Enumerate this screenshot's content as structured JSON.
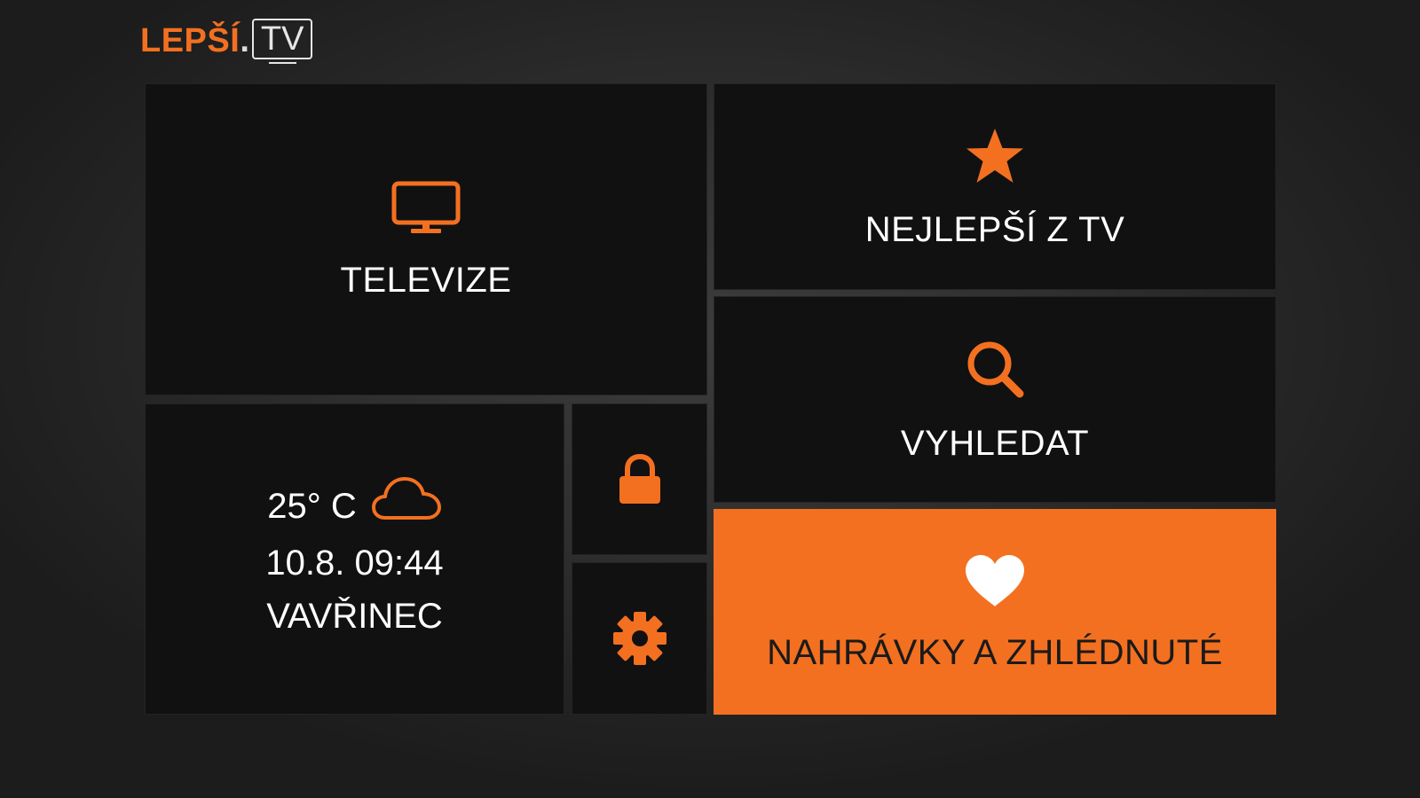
{
  "logo": {
    "brand": "LEPŠÍ",
    "dot": ".",
    "suffix": "TV"
  },
  "tiles": {
    "tv": {
      "label": "TELEVIZE",
      "icon": "tv-icon"
    },
    "best": {
      "label": "NEJLEPŠÍ Z TV",
      "icon": "star-icon"
    },
    "search": {
      "label": "VYHLEDAT",
      "icon": "search-icon"
    },
    "recordings": {
      "label": "NAHRÁVKY A ZHLÉDNUTÉ",
      "icon": "heart-icon",
      "highlighted": true
    },
    "lock": {
      "icon": "lock-icon"
    },
    "settings": {
      "icon": "gear-icon"
    }
  },
  "info": {
    "temperature": "25° C",
    "weather_icon": "cloud-icon",
    "datetime": "10.8. 09:44",
    "nameday": "VAVŘINEC"
  },
  "colors": {
    "accent": "#f37021",
    "tile_bg": "#111111",
    "text": "#ffffff"
  }
}
